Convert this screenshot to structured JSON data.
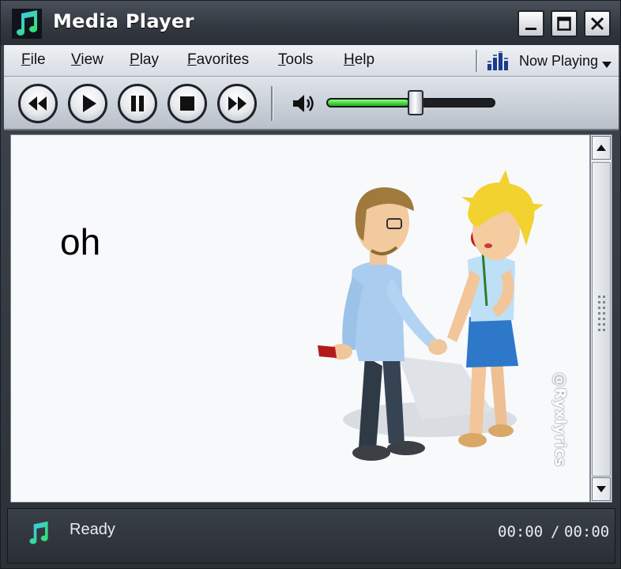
{
  "window": {
    "title": "Media Player",
    "icon": "music-note-icon",
    "controls": [
      "minimize-icon",
      "maximize-icon",
      "close-icon"
    ]
  },
  "menu": {
    "items": [
      {
        "label": "File",
        "underline": "F"
      },
      {
        "label": "View",
        "underline": "V"
      },
      {
        "label": "Play",
        "underline": "P"
      },
      {
        "label": "Favorites",
        "underline": "F"
      },
      {
        "label": "Tools",
        "underline": "T"
      },
      {
        "label": "Help",
        "underline": "H"
      }
    ],
    "now_playing": {
      "label": "Now Playing",
      "icon": "equalizer-icon"
    }
  },
  "toolbar": {
    "buttons": [
      "rewind-icon",
      "play-icon",
      "pause-icon",
      "stop-icon",
      "fast-forward-icon"
    ],
    "volume": {
      "icon": "speaker-icon",
      "level": 0.48,
      "fill_color": "#2ad22a"
    }
  },
  "video": {
    "lyric": "oh",
    "watermark": "@Ryxlyrics"
  },
  "status": {
    "text": "Ready",
    "time_current": "00:00",
    "time_separator": "/",
    "time_total": "00:00"
  },
  "colors": {
    "chrome_dark": "#2f343b",
    "accent_green": "#2ad22a",
    "note_cyan": "#3ec6ff"
  }
}
